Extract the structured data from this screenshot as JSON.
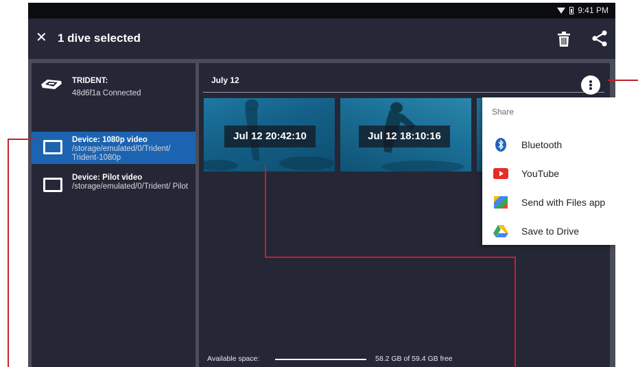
{
  "status_bar": {
    "time": "9:41 PM"
  },
  "action_bar": {
    "title": "1 dive selected"
  },
  "devices": {
    "trident": {
      "name": "TRIDENT:",
      "status": "48d6f1a Connected"
    },
    "items": [
      {
        "title": "Device: 1080p video",
        "path": "/storage/emulated/0/Trident/ Trident-1080p",
        "selected": true
      },
      {
        "title": "Device: Pilot video",
        "path": "/storage/emulated/0/Trident/ Pilot",
        "selected": false
      }
    ]
  },
  "gallery": {
    "date_header": "July 12",
    "thumbnails": [
      {
        "timestamp": "Jul 12 20:42:10"
      },
      {
        "timestamp": "Jul 12 18:10:16"
      }
    ]
  },
  "storage": {
    "label": "Available space:",
    "free_text": "58.2 GB of 59.4 GB free",
    "used_fraction": 0.02
  },
  "share_menu": {
    "header": "Share",
    "items": [
      {
        "label": "Bluetooth",
        "icon": "bluetooth-icon"
      },
      {
        "label": "YouTube",
        "icon": "youtube-icon"
      },
      {
        "label": "Send with Files app",
        "icon": "files-app-icon"
      },
      {
        "label": "Save to Drive",
        "icon": "drive-icon"
      }
    ]
  },
  "colors": {
    "toolbar": "#262837",
    "panel": "#252736",
    "selected_row": "#1c64b1",
    "callout": "#c0222e"
  }
}
